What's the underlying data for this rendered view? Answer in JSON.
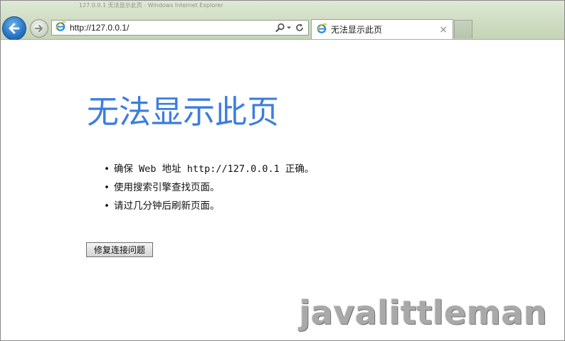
{
  "window": {
    "title": "127.0.0.1 无法显示此页 - Windows Internet Explorer"
  },
  "toolbar": {
    "back_icon": "back-arrow-icon",
    "forward_icon": "forward-arrow-icon",
    "address": {
      "url": "http://127.0.0.1/",
      "site_icon": "ie-logo-icon",
      "search_icon": "search-icon",
      "dropdown_icon": "chevron-down-icon",
      "refresh_icon": "refresh-icon"
    },
    "tabs": [
      {
        "title": "无法显示此页",
        "icon": "ie-logo-icon",
        "close_label": "×"
      }
    ]
  },
  "page": {
    "heading": "无法显示此页",
    "tips": [
      "确保 Web 地址 http://127.0.0.1 正确。",
      "使用搜索引擎查找页面。",
      "请过几分钟后刷新页面。"
    ],
    "bullet": "•",
    "fix_button_label": "修复连接问题"
  },
  "watermark": "javalittleman",
  "colors": {
    "heading": "#3c7de0",
    "back_button": "#2a78c8",
    "toolbar_bg": "#cfdcc2"
  }
}
